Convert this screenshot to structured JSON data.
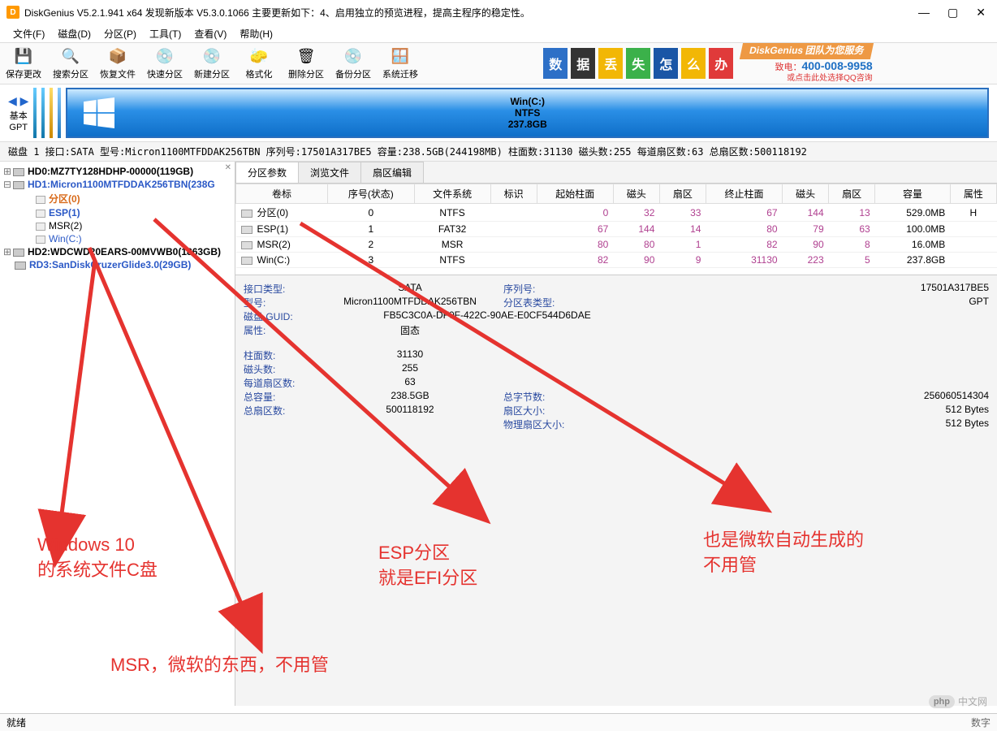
{
  "title": "DiskGenius V5.2.1.941 x64    发现新版本 V5.3.0.1066 主要更新如下：4、启用独立的预览进程，提高主程序的稳定性。",
  "menu": [
    "文件(F)",
    "磁盘(D)",
    "分区(P)",
    "工具(T)",
    "查看(V)",
    "帮助(H)"
  ],
  "toolbar": [
    {
      "label": "保存更改",
      "icon": "💾"
    },
    {
      "label": "搜索分区",
      "icon": "🔍"
    },
    {
      "label": "恢复文件",
      "icon": "📦"
    },
    {
      "label": "快速分区",
      "icon": "💿"
    },
    {
      "label": "新建分区",
      "icon": "💿"
    },
    {
      "label": "格式化",
      "icon": "🧽"
    },
    {
      "label": "删除分区",
      "icon": "🗑"
    },
    {
      "label": "备份分区",
      "icon": "💿"
    },
    {
      "label": "系统迁移",
      "icon": "🪟"
    }
  ],
  "banner": {
    "chars": [
      {
        "t": "数",
        "bg": "#2d70c7"
      },
      {
        "t": "据",
        "bg": "#333333"
      },
      {
        "t": "丢",
        "bg": "#f2b705"
      },
      {
        "t": "失",
        "bg": "#3bb14a"
      },
      {
        "t": "怎",
        "bg": "#1a56a6"
      },
      {
        "t": "么",
        "bg": "#f2b705"
      },
      {
        "t": "办",
        "bg": "#e03a3a"
      }
    ],
    "ribbon": "DiskGenius 团队为您服务",
    "telLabel": "致电：",
    "tel": "400-008-9958",
    "note": "或点击此处选择QQ咨询"
  },
  "nav": {
    "arrowsLabel": "基本",
    "gpt": "GPT"
  },
  "partitionVisual": {
    "name": "Win(C:)",
    "fs": "NTFS",
    "size": "237.8GB"
  },
  "infostrip": "磁盘 1  接口:SATA  型号:Micron1100MTFDDAK256TBN   序列号:17501A317BE5  容量:238.5GB(244198MB)  柱面数:31130  磁头数:255  每道扇区数:63  总扇区数:500118192",
  "tree": {
    "hd0": "HD0:MZ7TY128HDHP-00000(119GB)",
    "hd1": "HD1:Micron1100MTFDDAK256TBN(238G",
    "hd1_children": [
      {
        "label": "分区(0)",
        "cls": "sel-orange"
      },
      {
        "label": "ESP(1)",
        "cls": "sel-blue"
      },
      {
        "label": "MSR(2)",
        "cls": ""
      },
      {
        "label": "Win(C:)",
        "cls": "sel-blue2"
      }
    ],
    "hd2": "HD2:WDCWD20EARS-00MVWB0(1863GB)",
    "rd3": "RD3:SanDiskCruzerGlide3.0(29GB)"
  },
  "tabs": [
    "分区参数",
    "浏览文件",
    "扇区编辑"
  ],
  "tableHeaders": [
    "卷标",
    "序号(状态)",
    "文件系统",
    "标识",
    "起始柱面",
    "磁头",
    "扇区",
    "终止柱面",
    "磁头",
    "扇区",
    "容量",
    "属性"
  ],
  "rows": [
    {
      "label": "分区(0)",
      "seq": "0",
      "fs": "NTFS",
      "flag": "",
      "sc": "0",
      "sh": "32",
      "ss": "33",
      "ec": "67",
      "eh": "144",
      "es": "13",
      "cap": "529.0MB",
      "attr": "H",
      "labelcls": "sel-orange"
    },
    {
      "label": "ESP(1)",
      "seq": "1",
      "fs": "FAT32",
      "flag": "",
      "sc": "67",
      "sh": "144",
      "ss": "14",
      "ec": "80",
      "eh": "79",
      "es": "63",
      "cap": "100.0MB",
      "attr": "",
      "labelcls": "sel-blue"
    },
    {
      "label": "MSR(2)",
      "seq": "2",
      "fs": "MSR",
      "flag": "",
      "sc": "80",
      "sh": "80",
      "ss": "1",
      "ec": "82",
      "eh": "90",
      "es": "8",
      "cap": "16.0MB",
      "attr": "",
      "labelcls": ""
    },
    {
      "label": "Win(C:)",
      "seq": "3",
      "fs": "NTFS",
      "flag": "",
      "sc": "82",
      "sh": "90",
      "ss": "9",
      "ec": "31130",
      "eh": "223",
      "es": "5",
      "cap": "237.8GB",
      "attr": "",
      "labelcls": "sel-blue2"
    }
  ],
  "detail": {
    "iface_k": "接口类型:",
    "iface_v": "SATA",
    "serial_k": "序列号:",
    "serial_v": "17501A317BE5",
    "model_k": "型号:",
    "model_v": "Micron1100MTFDDAK256TBN",
    "pttype_k": "分区表类型:",
    "pttype_v": "GPT",
    "guid_k": "磁盘 GUID:",
    "guid_v": "FB5C3C0A-DF0F-422C-90AE-E0CF544D6DAE",
    "attr_k": "属性:",
    "attr_v": "固态",
    "cyl_k": "柱面数:",
    "cyl_v": "31130",
    "heads_k": "磁头数:",
    "heads_v": "255",
    "spt_k": "每道扇区数:",
    "spt_v": "63",
    "totcap_k": "总容量:",
    "totcap_v": "238.5GB",
    "bytes_k": "总字节数:",
    "bytes_v": "256060514304",
    "totsec_k": "总扇区数:",
    "totsec_v": "500118192",
    "secsz_k": "扇区大小:",
    "secsz_v": "512 Bytes",
    "physz_k": "物理扇区大小:",
    "physz_v": "512 Bytes"
  },
  "annotations": {
    "win10": "Windows 10\n的系统文件C盘",
    "msr": "MSR，微软的东西，不用管",
    "esp": "ESP分区\n就是EFI分区",
    "msgen": "也是微软自动生成的\n不用管"
  },
  "status": {
    "left": "就绪",
    "right": "数字"
  },
  "watermark": "中文网"
}
